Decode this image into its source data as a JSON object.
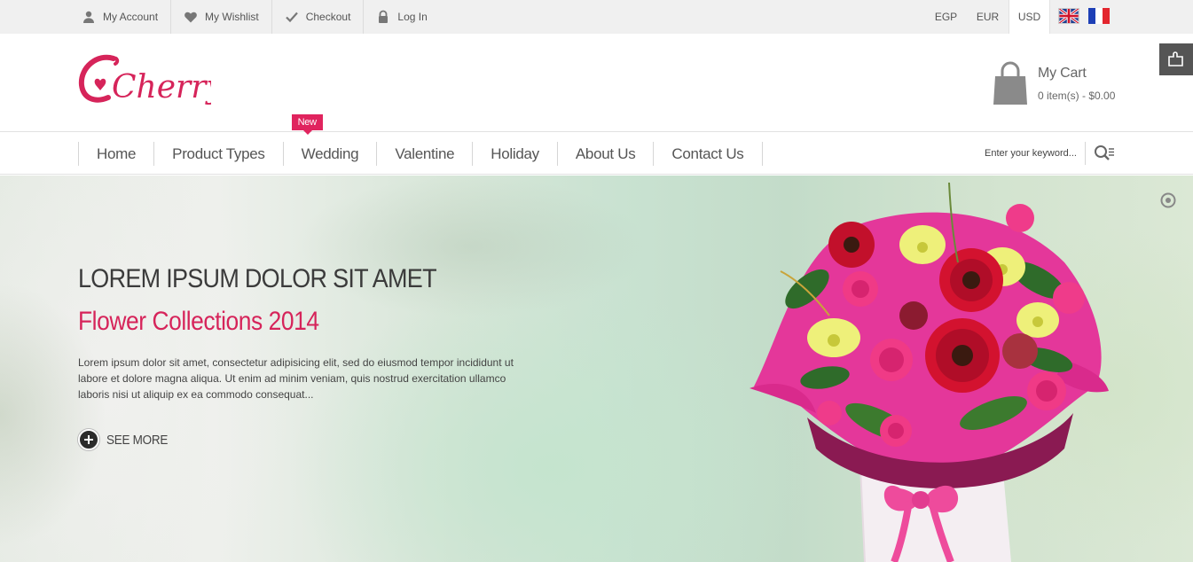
{
  "topbar": {
    "links": [
      {
        "label": "My Account",
        "icon": "user-icon"
      },
      {
        "label": "My Wishlist",
        "icon": "heart-icon"
      },
      {
        "label": "Checkout",
        "icon": "check-icon"
      },
      {
        "label": "Log In",
        "icon": "lock-icon"
      }
    ],
    "currencies": [
      "EGP",
      "EUR",
      "USD"
    ],
    "active_currency": "USD",
    "languages": [
      "english-flag-icon",
      "french-flag-icon"
    ]
  },
  "header": {
    "logo_text": "Cherry",
    "cart": {
      "title": "My Cart",
      "summary": "0 item(s) - $0.00"
    }
  },
  "nav": {
    "items": [
      {
        "label": "Home"
      },
      {
        "label": "Product Types"
      },
      {
        "label": "Wedding",
        "badge": "New"
      },
      {
        "label": "Valentine"
      },
      {
        "label": "Holiday"
      },
      {
        "label": "About Us"
      },
      {
        "label": "Contact Us"
      }
    ],
    "search_placeholder": "Enter your keyword..."
  },
  "hero": {
    "heading": "LOREM IPSUM DOLOR SIT AMET",
    "subheading": "Flower Collections 2014",
    "body": "Lorem ipsum dolor sit amet, consectetur adipisicing elit, sed do eiusmod tempor incididunt ut labore et dolore magna aliqua. Ut enim ad minim veniam, quis nostrud exercitation ullamco laboris nisi ut aliquip ex ea commodo consequat...",
    "cta": "SEE MORE"
  },
  "colors": {
    "accent": "#d6245a",
    "topbar_bg": "#f0f0f0",
    "text": "#444444"
  }
}
